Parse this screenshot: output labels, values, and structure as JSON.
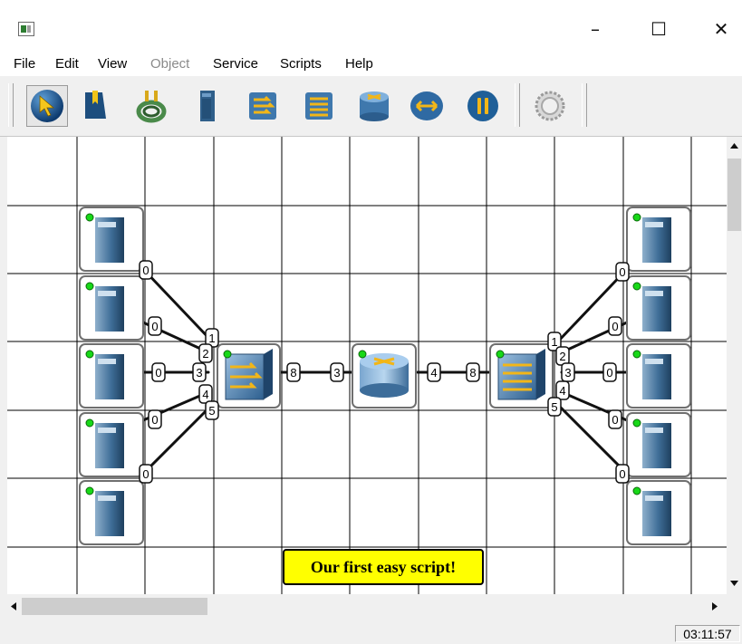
{
  "window": {
    "minimize_glyph": "–",
    "maximize_glyph": "☐",
    "close_glyph": "✕"
  },
  "menu": [
    "File",
    "Edit",
    "View",
    "Object",
    "Service",
    "Scripts",
    "Help"
  ],
  "menu_disabled": [
    "Object"
  ],
  "toolbar": {
    "tools": [
      "select-arrow-icon",
      "bookmark-icon",
      "cable-icon",
      "computer-icon",
      "switch-icon",
      "hub-icon",
      "router-icon",
      "bridge-icon",
      "pause-icon",
      "gear-icon"
    ],
    "active_tool": "select-arrow-icon",
    "disabled_tools": [
      "gear-icon"
    ]
  },
  "network": {
    "left_computers": 5,
    "right_computers": 5,
    "status_led_color": "#18d818",
    "left_host_ports": [
      "0",
      "0",
      "0",
      "0",
      "0"
    ],
    "left_switch_ports": [
      "1",
      "2",
      "3",
      "4",
      "5"
    ],
    "right_host_ports": [
      "0",
      "0",
      "0",
      "0",
      "0"
    ],
    "right_switch_ports": [
      "1",
      "2",
      "3",
      "4",
      "5"
    ],
    "trunk_ports": [
      "8",
      "3",
      "4",
      "8"
    ]
  },
  "note_text": "Our first easy script!",
  "status": {
    "time": "03:11:57"
  },
  "colors": {
    "note_bg": "#ffff00",
    "device_blue": "#5a86b0",
    "accent_yellow": "#f2b618"
  }
}
